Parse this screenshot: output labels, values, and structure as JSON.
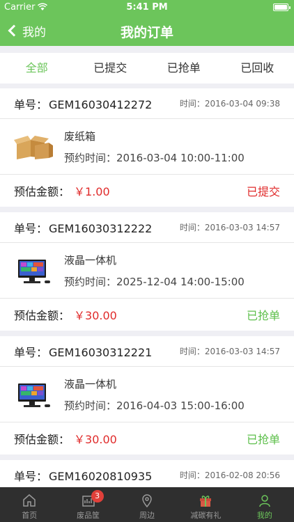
{
  "status_bar": {
    "carrier": "Carrier",
    "time": "5:41 PM"
  },
  "nav": {
    "back_label": "我的",
    "title": "我的订单"
  },
  "tabs": [
    {
      "label": "全部",
      "active": true
    },
    {
      "label": "已提交",
      "active": false
    },
    {
      "label": "已抢单",
      "active": false
    },
    {
      "label": "已回收",
      "active": false
    }
  ],
  "labels": {
    "order_no": "单号：",
    "time": "时间：",
    "appointment": "预约时间：",
    "estimate": "预估金额："
  },
  "orders": [
    {
      "order_no": "GEM16030412272",
      "time": "2016-03-04 09:38",
      "item": "废纸箱",
      "appointment": "2016-03-04 10:00-11:00",
      "amount": "￥1.00",
      "status": "已提交",
      "icon": "cardboard-box-icon"
    },
    {
      "order_no": "GEM16030312222",
      "time": "2016-03-03 14:57",
      "item": "液晶一体机",
      "appointment": "2025-12-04 14:00-15:00",
      "amount": "￥30.00",
      "status": "已抢单",
      "icon": "all-in-one-pc-icon"
    },
    {
      "order_no": "GEM16030312221",
      "time": "2016-03-03 14:57",
      "item": "液晶一体机",
      "appointment": "2016-04-03 15:00-16:00",
      "amount": "￥30.00",
      "status": "已抢单",
      "icon": "all-in-one-pc-icon"
    },
    {
      "order_no": "GEM16020810935",
      "time": "2016-02-08 20:56"
    }
  ],
  "tab_bar": [
    {
      "label": "首页",
      "icon": "home-icon"
    },
    {
      "label": "废品筐",
      "icon": "basket-icon",
      "badge": "3"
    },
    {
      "label": "周边",
      "icon": "location-pin-icon"
    },
    {
      "label": "减碳有礼",
      "icon": "gift-icon"
    },
    {
      "label": "我的",
      "icon": "person-icon",
      "active": true
    }
  ],
  "colors": {
    "brand_green": "#6cc55b",
    "alert_red": "#e02b2b",
    "tabbar_bg": "#2f2f2f"
  }
}
